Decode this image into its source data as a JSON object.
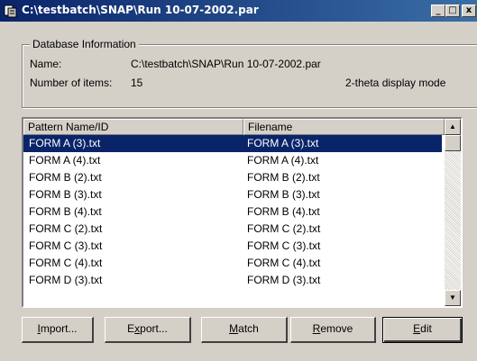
{
  "window": {
    "title": "C:\\testbatch\\SNAP\\Run 10-07-2002.par",
    "minimize_glyph": "_",
    "maximize_glyph": "□",
    "close_glyph": "x"
  },
  "database_info": {
    "group_label": "Database Information",
    "name_label": "Name:",
    "name_value": "C:\\testbatch\\SNAP\\Run 10-07-2002.par",
    "items_label": "Number of items:",
    "items_value": "15",
    "display_mode": "2-theta display mode"
  },
  "list": {
    "columns": [
      "Pattern Name/ID",
      "Filename"
    ],
    "rows": [
      {
        "name": "FORM A (3).txt",
        "file": "FORM A (3).txt"
      },
      {
        "name": "FORM A (4).txt",
        "file": "FORM A (4).txt"
      },
      {
        "name": "FORM B (2).txt",
        "file": "FORM B (2).txt"
      },
      {
        "name": "FORM B (3).txt",
        "file": "FORM B (3).txt"
      },
      {
        "name": "FORM B (4).txt",
        "file": "FORM B (4).txt"
      },
      {
        "name": "FORM C (2).txt",
        "file": "FORM C (2).txt"
      },
      {
        "name": "FORM C (3).txt",
        "file": "FORM C (3).txt"
      },
      {
        "name": "FORM C (4).txt",
        "file": "FORM C (4).txt"
      },
      {
        "name": "FORM D (3).txt",
        "file": "FORM D (3).txt"
      }
    ],
    "scroll_up_glyph": "▲",
    "scroll_down_glyph": "▼"
  },
  "buttons": {
    "import": {
      "mnemonic": "I",
      "rest": "mport..."
    },
    "export": {
      "pre": "E",
      "mnemonic": "x",
      "rest": "port..."
    },
    "match": {
      "mnemonic": "M",
      "rest": "atch"
    },
    "remove": {
      "mnemonic": "R",
      "rest": "emove"
    },
    "edit": {
      "mnemonic": "E",
      "rest": "dit"
    }
  },
  "colors": {
    "title_bar": "#0a246a",
    "selection": "#0a246a",
    "dialog_face": "#d4d0c8"
  }
}
